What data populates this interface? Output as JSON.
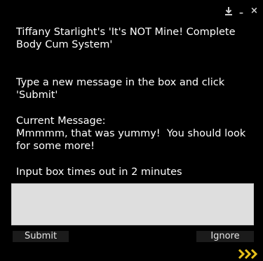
{
  "window": {
    "controls": {
      "download_icon": "download-icon",
      "minimize_symbol": "–",
      "close_symbol": "×"
    }
  },
  "dialog": {
    "title": "Tiffany Starlight's 'It's NOT Mine! Complete Body Cum System'",
    "instruction": "Type a new message in the box and click 'Submit'",
    "current_message_label": "Current Message:",
    "current_message_text": "Mmmmm, that was yummy!  You should look for some more!",
    "timeout_text": "Input box times out in 2 minutes",
    "input_value": "",
    "submit_label": "Submit",
    "ignore_label": "Ignore"
  },
  "colors": {
    "background": "#000000",
    "text": "#ffffff",
    "input_bg": "#dedede",
    "button_bg": "#1b1b1b",
    "arrow_accent": "#e8c21a"
  }
}
